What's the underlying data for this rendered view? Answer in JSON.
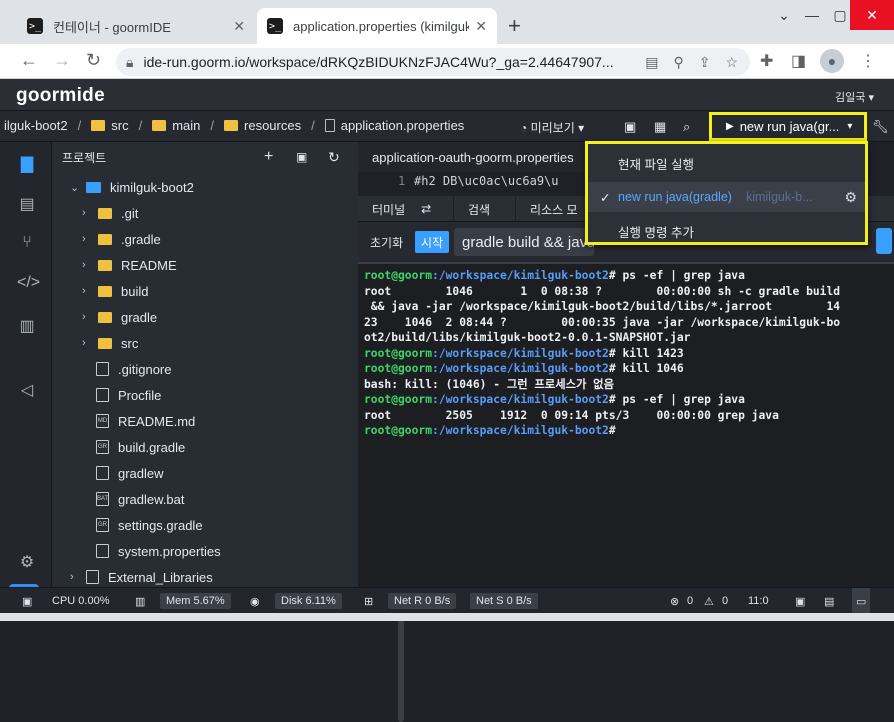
{
  "browser": {
    "tabs": [
      {
        "title": "컨테이너 - goormIDE",
        "close": "✕"
      },
      {
        "title": "application.properties (kimilguk-",
        "close": "✕"
      }
    ],
    "new_tab": "+",
    "url": "ide-run.goorm.io/workspace/dRKQzBIDUKNzFJAC4Wu?_ga=2.44647907..."
  },
  "ide": {
    "logo": "goormide",
    "user": "김일국",
    "breadcrumb": [
      "ilguk-boot2",
      "src",
      "main",
      "resources",
      "application.properties"
    ],
    "preview_label": "미리보기",
    "run_button_label": "new run java(gr..."
  },
  "dropdown": {
    "items": [
      {
        "label": "현재 파일 실행",
        "sub": ""
      },
      {
        "label": "new run java(gradle)",
        "sub": "kimilguk-b..."
      },
      {
        "label": "실행 명령 추가",
        "sub": ""
      }
    ]
  },
  "project": {
    "title": "프로젝트",
    "root": "kimilguk-boot2",
    "items": [
      {
        "label": ".git",
        "kind": "folder"
      },
      {
        "label": ".gradle",
        "kind": "folder"
      },
      {
        "label": "README",
        "kind": "folder"
      },
      {
        "label": "build",
        "kind": "folder"
      },
      {
        "label": "gradle",
        "kind": "folder"
      },
      {
        "label": "src",
        "kind": "folder"
      },
      {
        "label": ".gitignore",
        "kind": "file"
      },
      {
        "label": "Procfile",
        "kind": "file"
      },
      {
        "label": "README.md",
        "kind": "md"
      },
      {
        "label": "build.gradle",
        "kind": "gradle"
      },
      {
        "label": "gradlew",
        "kind": "file"
      },
      {
        "label": "gradlew.bat",
        "kind": "bat"
      },
      {
        "label": "settings.gradle",
        "kind": "gradle"
      },
      {
        "label": "system.properties",
        "kind": "file"
      }
    ],
    "external": "External_Libraries"
  },
  "editor": {
    "tab": "application-oauth-goorm.properties",
    "line_number": "1",
    "code": "#h2 DB\\uc0ac\\uc6a9\\u"
  },
  "terminal_tabs": {
    "terminal": "터미널",
    "search": "검색",
    "resource": "리소스 모"
  },
  "terminal_bar": {
    "reset": "초기화",
    "start": "시작",
    "command": "gradle build && java"
  },
  "terminal": [
    {
      "prompt": "root@goorm",
      "path": ":/workspace/kimilguk-boot2",
      "cmd": "# ps -ef | grep java"
    },
    {
      "text": "root        1046       1  0 08:38 ?        00:00:00 sh -c gradle build"
    },
    {
      "text": " && java -jar /workspace/kimilguk-boot2/build/libs/*.jarroot        14"
    },
    {
      "text": "23    1046  2 08:44 ?        00:00:35 java -jar /workspace/kimilguk-bo"
    },
    {
      "text": "ot2/build/libs/kimilguk-boot2-0.0.1-SNAPSHOT.jar"
    },
    {
      "prompt": "root@goorm",
      "path": ":/workspace/kimilguk-boot2",
      "cmd": "# kill 1423"
    },
    {
      "prompt": "root@goorm",
      "path": ":/workspace/kimilguk-boot2",
      "cmd": "# kill 1046"
    },
    {
      "text": "bash: kill: (1046) - 그런 프로세스가 없음"
    },
    {
      "prompt": "root@goorm",
      "path": ":/workspace/kimilguk-boot2",
      "cmd": "# ps -ef | grep java"
    },
    {
      "text": "root        2505    1912  0 09:14 pts/3    00:00:00 grep java"
    },
    {
      "prompt": "root@goorm",
      "path": ":/workspace/kimilguk-boot2",
      "cmd": "#"
    }
  ],
  "status": {
    "cpu": "CPU 0.00%",
    "mem": "Mem 5.67%",
    "disk": "Disk 6.11%",
    "net_r": "Net R 0 B/s",
    "net_s": "Net S 0 B/s",
    "errors": "0",
    "warnings": "0",
    "position": "11:0"
  }
}
